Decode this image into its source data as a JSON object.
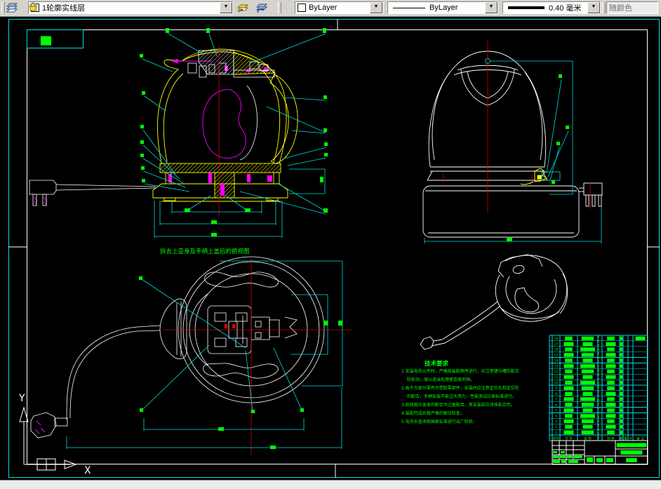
{
  "toolbar": {
    "layer_name": "1轮廓实线层",
    "color": "ByLayer",
    "linetype": "ByLayer",
    "lineweight": "0.40 毫米",
    "plot_style": "随颜色"
  },
  "sheet": {
    "corner_label": "█▊",
    "top_view_label": "拆去上壶身及手柄上盖后的俯视图"
  },
  "tech": {
    "title": "技术要求",
    "lines": [
      "1.安装电热元件时，严格按装配顺序进行，应注意键与槽的配合",
      "防松动，施以适当处理使连接牢固。",
      "2.由于大部分零件为塑胶零部件，安装时应注意定位孔和定位柱",
      "的配合，手柄安装不能过大用力，性能测试应按标准进行。",
      "3.底座圈与壶身的配合为过盈配合，其安装前应涂抹粘合剂。",
      "4.装配完成后做严格的耐压检查。",
      "5.电热水壶须按国家标准进行出厂检验。"
    ]
  },
  "ucs": {
    "x_label": "X",
    "y_label": "Y"
  },
  "bom": {
    "headers": [
      "序号",
      "代 号",
      "名 称",
      "",
      "材 料",
      "数",
      "量",
      "计",
      "备 注"
    ],
    "rows": [
      [
        "18",
        "███",
        "█████",
        "",
        "███",
        "█",
        "",
        "",
        "████"
      ],
      [
        "17",
        "████",
        "████",
        "",
        "████",
        "█",
        "",
        "",
        ""
      ],
      [
        "16",
        "███",
        "██████",
        "",
        "███",
        "█",
        "",
        "",
        ""
      ],
      [
        "15",
        "████",
        "█████",
        "",
        "████",
        "█",
        "",
        "",
        ""
      ],
      [
        "14",
        "███",
        "████",
        "",
        "███",
        "█",
        "",
        "",
        ""
      ],
      [
        "13",
        "████",
        "██████",
        "",
        "████",
        "█",
        "",
        "",
        ""
      ],
      [
        "12",
        "███",
        "█████",
        "",
        "███",
        "█",
        "",
        "",
        ""
      ],
      [
        "11",
        "████",
        "████",
        "",
        "████",
        "█",
        "",
        "",
        ""
      ],
      [
        "10",
        "███",
        "██████",
        "",
        "███",
        "█",
        "",
        "",
        ""
      ],
      [
        "9",
        "████",
        "█████",
        "",
        "███",
        "█",
        "",
        "",
        ""
      ],
      [
        "8",
        "███",
        "████",
        "",
        "████",
        "█",
        "",
        "",
        ""
      ],
      [
        "7",
        "████",
        "██████",
        "",
        "███",
        "█",
        "",
        "",
        ""
      ],
      [
        "6",
        "███",
        "█████",
        "",
        "████",
        "█",
        "",
        "",
        ""
      ],
      [
        "5",
        "████",
        "████",
        "",
        "███",
        "█",
        "",
        "",
        ""
      ],
      [
        "4",
        "███",
        "██████",
        "",
        "████",
        "█",
        "",
        "",
        ""
      ],
      [
        "3",
        "████",
        "█████",
        "",
        "███",
        "█",
        "",
        "",
        ""
      ],
      [
        "2",
        "███",
        "████",
        "",
        "████",
        "█",
        "",
        "",
        ""
      ],
      [
        "1",
        "████",
        "█████",
        "",
        "███",
        "█",
        "",
        "",
        ""
      ]
    ]
  },
  "title_block": {
    "project": "███████████",
    "drawing_name": "████████",
    "drawing_no": "████"
  },
  "colors": {
    "accent_cyan": "#00dcdc",
    "line_green": "#00ff00",
    "line_yellow": "#ffff00",
    "line_magenta": "#ff00ff",
    "line_red": "#dd0000"
  }
}
